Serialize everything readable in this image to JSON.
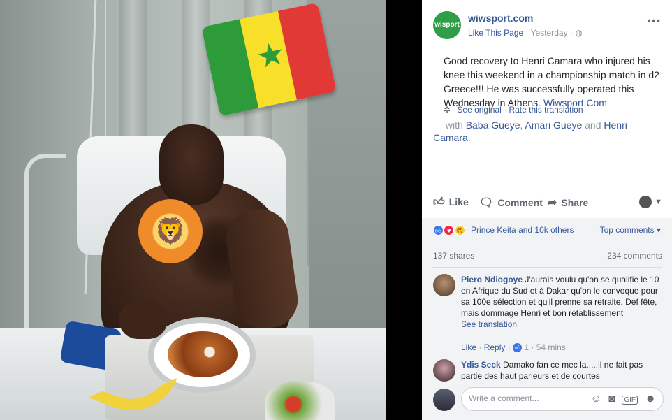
{
  "photo": {
    "flag_emoji": "flag-senegal",
    "lion_emoji": "🦁"
  },
  "post": {
    "page_avatar_text": "wisport",
    "page_name": "wiwsport.com",
    "like_page": "Like This Page",
    "time": "Yesterday",
    "audience_icon": "globe-icon",
    "more": "•••",
    "text": "Good recovery to Henri Camara who injured his knee this weekend in a championship match in d2 Greece!!! He was successfully operated this Wednesday in Athens.",
    "text_link": "Wiwsport.Com",
    "see_original": "See original",
    "rate_translation": "Rate this translation",
    "with_prefix": "— with",
    "tag_1": "Baba Gueye",
    "tag_2": "Amari Gueye",
    "and": "and",
    "tag_3": "Henri Camara"
  },
  "actions": {
    "like": "Like",
    "comment": "Comment",
    "share": "Share"
  },
  "reactions": {
    "names": "Prince Keita and 10k others",
    "top_comments": "Top comments",
    "shares": "137 shares",
    "comments": "234 comments"
  },
  "comments": [
    {
      "name": "Piero Ndiogoye",
      "text": "J'aurais voulu qu'on se qualifie le 10 en Afrique du Sud et à Dakar qu'on le convoque pour sa 100e sélection et qu'il prenne sa retraite. Def fête, mais dommage Henri et bon rétablissement",
      "see_translation": "See translation",
      "like": "Like",
      "reply": "Reply",
      "like_count": "1",
      "time": "54 mins"
    },
    {
      "name": "Ydis Seck",
      "text": "Damako fan ce mec la.....il ne fait pas partie des haut parleurs et de courtes"
    }
  ],
  "composer": {
    "placeholder": "Write a comment..."
  },
  "colors": {
    "link_blue": "#365899",
    "page_green": "#2e9f47",
    "like_blue": "#3b74e8"
  }
}
